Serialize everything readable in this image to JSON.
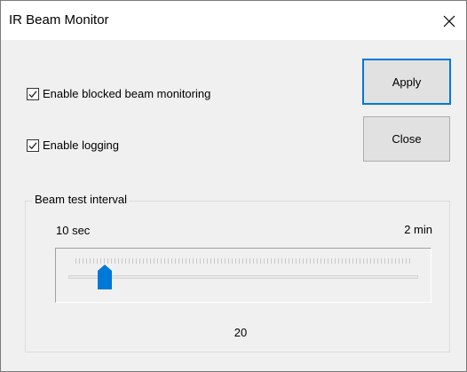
{
  "window": {
    "title": "IR Beam Monitor",
    "close_icon": "close-icon"
  },
  "options": {
    "blocked_beam": {
      "label": "Enable blocked beam monitoring",
      "checked": true
    },
    "logging": {
      "label": "Enable logging",
      "checked": true
    }
  },
  "buttons": {
    "apply_label": "Apply",
    "close_label": "Close"
  },
  "beam_test": {
    "group_label": "Beam test interval",
    "min_label": "10 sec",
    "max_label": "2 min",
    "value": "20",
    "slider": {
      "min": 10,
      "max": 120,
      "value": 20
    }
  },
  "colors": {
    "accent": "#0078d7",
    "window_bg": "#f0f0f0",
    "button_bg": "#e1e1e1"
  }
}
